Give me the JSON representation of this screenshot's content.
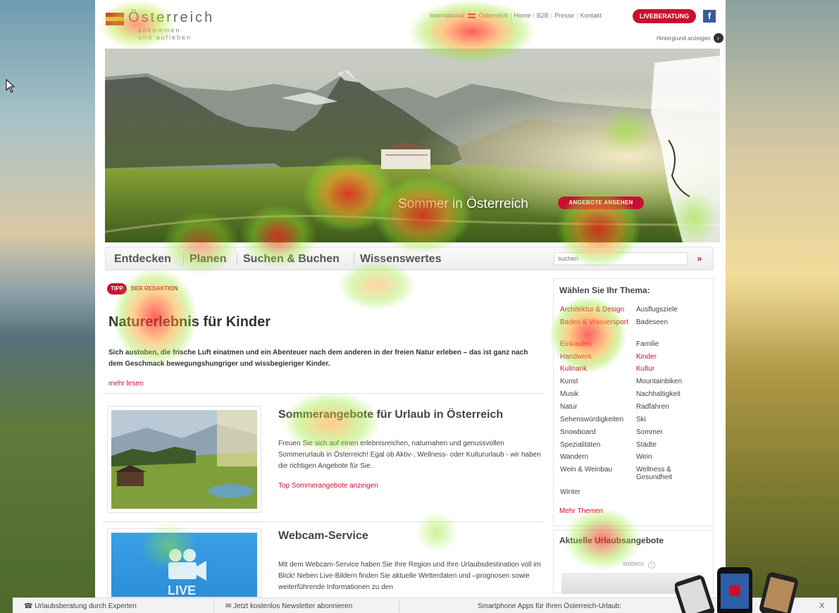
{
  "brand": {
    "title": "Österreich",
    "subline1": "ankommen",
    "subline2": "und aufleben"
  },
  "topnav": {
    "international": "International",
    "country": "Österreich",
    "home": "Home",
    "b2b": "B2B",
    "presse": "Presse",
    "kontakt": "Kontakt",
    "live_button": "LIVEBERATUNG",
    "social": "f"
  },
  "background_toggle": "Hintergrund anzeigen",
  "hero": {
    "title": "Sommer in Österreich",
    "button": "ANGEBOTE ANSEHEN"
  },
  "main_nav": {
    "items": [
      "Entdecken",
      "Planen",
      "Suchen & Buchen",
      "Wissenswertes"
    ],
    "search_placeholder": "suchen",
    "search_go": "»"
  },
  "feature": {
    "tag": "TIPP",
    "tag_label": "DER REDAKTION",
    "title": "Naturerlebnis für Kinder",
    "text": "Sich austoben, die frische Luft einatmen und ein Abenteuer nach dem anderen in der freien Natur erleben – das ist ganz nach dem Geschmack bewegungshungriger und wissbegieriger Kinder.",
    "more": "mehr lesen"
  },
  "teasers": [
    {
      "title": "Sommerangebote für Urlaub in Österreich",
      "text": "Freuen Sie sich auf einen erlebnisreichen, naturnahen und genussvollen Sommerurlaub in Österreich! Egal ob Aktiv-, Wellness- oder Kultururlaub - wir haben die richtigen Angebote für Sie.",
      "link": "Top Sommerangebote anzeigen"
    },
    {
      "title": "Webcam-Service",
      "text": "Mit dem Webcam-Service haben Sie Ihre Region und Ihre Urlaubsdestination voll im Blick! Neben Live-Bildern finden Sie aktuelle Wetterdaten und –prognosen sowie weiterführende Informationen zu den",
      "badge": "LIVE"
    }
  ],
  "sidebar": {
    "heading": "Wählen Sie Ihr Thema:",
    "col1": [
      "Architektur & Design",
      "Baden & Wassersport",
      "Einkaufen",
      "Handwerk",
      "Kulinarik",
      "Kunst",
      "Musik",
      "Natur",
      "Sehenswürdigkeiten",
      "Snowboard",
      "Spezialitäten",
      "Wandern",
      "Wein & Weinbau",
      "Winter"
    ],
    "col2": [
      "Ausflugsziele",
      "Badeseen",
      "Familie",
      "Kinder",
      "Kultur",
      "Mountainbiken",
      "Nachhaltigkeit",
      "Radfahren",
      "Ski",
      "Sommer",
      "Städte",
      "Wein",
      "Wellness & Gesundheit"
    ],
    "more": "Mehr Themen",
    "offers_heading": "Aktuelle Urlaubsangebote",
    "browse": "stöbern",
    "browse_arrow": "›"
  },
  "bottom_bar": {
    "consult": "Urlaubsberatung durch Experten",
    "newsletter": "Jetzt kostenlos Newsletter abonnieren",
    "apps": "Smartphone Apps für Ihren Österreich-Urlaub:",
    "close": "X"
  },
  "colors": {
    "accent": "#c8102e",
    "text": "#333333",
    "nav_text": "#555555"
  }
}
